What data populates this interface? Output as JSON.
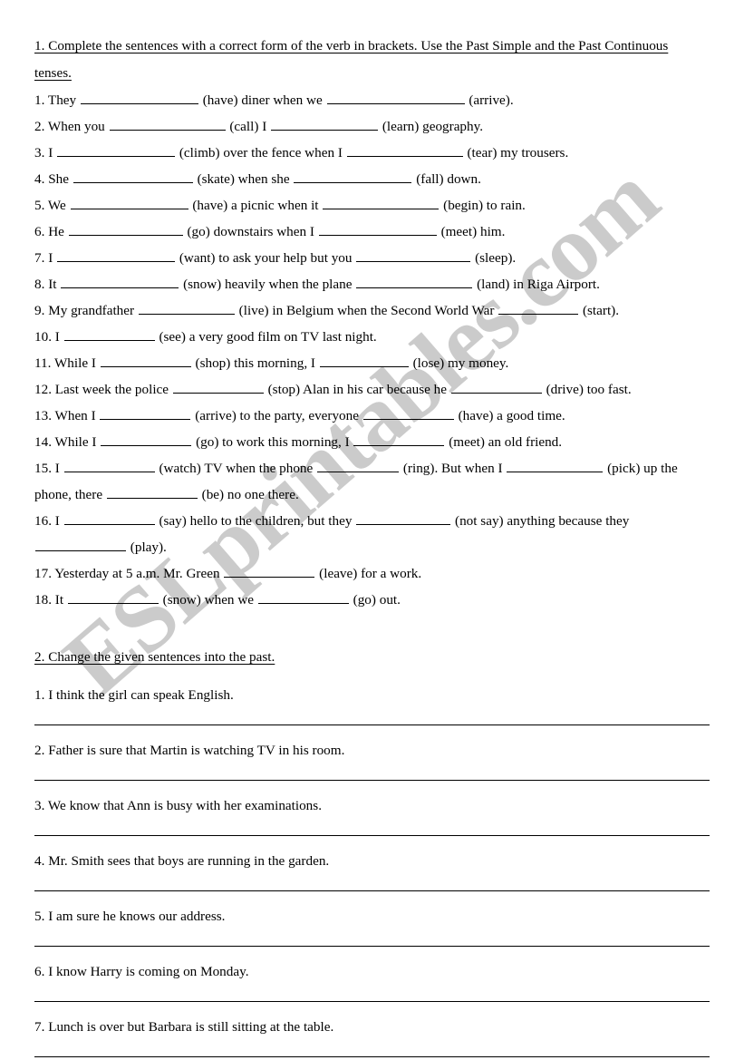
{
  "document": {
    "watermark": "ESLprintables.com",
    "accent_color": "#c9c9c9",
    "text_color": "#000000",
    "background_color": "#ffffff"
  },
  "task1": {
    "heading": "1. Complete the sentences with a correct form of the verb in brackets. Use the Past Simple and the Past Continuous tenses.",
    "items": [
      {
        "num": "1.",
        "p1": "They",
        "b1": 130,
        "p2": "(have) diner when we",
        "b2": 152,
        "p3": "(arrive)."
      },
      {
        "num": "2.",
        "p1": "When you",
        "b1": 128,
        "p2": "(call) I",
        "b2": 118,
        "p3": "(learn) geography."
      },
      {
        "num": "3.",
        "p1": "I",
        "b1": 130,
        "p2": "(climb) over the fence when I",
        "b2": 128,
        "p3": "(tear) my trousers."
      },
      {
        "num": "4.",
        "p1": "She",
        "b1": 132,
        "p2": "(skate) when she",
        "b2": 130,
        "p3": "(fall) down."
      },
      {
        "num": "5.",
        "p1": "We",
        "b1": 130,
        "p2": "(have) a picnic when it",
        "b2": 128,
        "p3": "(begin) to rain."
      },
      {
        "num": "6.",
        "p1": "He",
        "b1": 126,
        "p2": "(go) downstairs when I",
        "b2": 130,
        "p3": "(meet) him."
      },
      {
        "num": "7.",
        "p1": "I",
        "b1": 130,
        "p2": "(want) to ask your help but you",
        "b2": 126,
        "p3": "(sleep)."
      },
      {
        "num": "8.",
        "p1": "It",
        "b1": 130,
        "p2": "(snow) heavily when the plane",
        "b2": 128,
        "p3": "(land) in Riga Airport."
      },
      {
        "num": "9.",
        "p1": "My grandfather",
        "b1": 106,
        "p2": "(live) in Belgium when the Second World War",
        "b2": 88,
        "p3": "(start)."
      },
      {
        "num": "10.",
        "p1": "I",
        "b1": 100,
        "p2": "(see) a very good film on TV last night.",
        "b2": 0,
        "p3": ""
      },
      {
        "num": "11.",
        "p1": "While I",
        "b1": 100,
        "p2": "(shop) this morning, I",
        "b2": 98,
        "p3": "(lose) my money."
      },
      {
        "num": "12.",
        "p1": "Last week the police",
        "b1": 100,
        "p2": "(stop) Alan in his car because he",
        "b2": 100,
        "p3": "(drive) too fast."
      },
      {
        "num": "13.",
        "p1": "When I",
        "b1": 100,
        "p2": "(arrive) to the party, everyone",
        "b2": 100,
        "p3": "(have) a good time."
      },
      {
        "num": "14.",
        "p1": "While I",
        "b1": 100,
        "p2": "(go) to work this morning, I",
        "b2": 100,
        "p3": "(meet) an old friend."
      }
    ],
    "item15": {
      "num": "15.",
      "p1": "I",
      "b1": 100,
      "p2": "(watch) TV when the phone",
      "b2": 90,
      "p3": "(ring). But when I",
      "b3": 106,
      "p4": "(pick) up the phone, there",
      "b4": 100,
      "p5": "(be) no one there."
    },
    "item16": {
      "num": "16.",
      "p1": "I",
      "b1": 100,
      "p2": "(say) hello to the children, but they",
      "b2": 104,
      "p3": "(not say) anything because they",
      "b3": 100,
      "p4": "(play)."
    },
    "items_tail": [
      {
        "num": "17.",
        "p1": "Yesterday at 5 a.m. Mr. Green",
        "b1": 100,
        "p2": "(leave) for a work.",
        "b2": 0,
        "p3": ""
      },
      {
        "num": "18.",
        "p1": "It",
        "b1": 100,
        "p2": "(snow) when we",
        "b2": 100,
        "p3": "(go) out."
      }
    ]
  },
  "task2": {
    "heading": "2. Change the given sentences into the past.",
    "items": [
      {
        "num": "1.",
        "text": "I think the girl can speak English."
      },
      {
        "num": "2.",
        "text": "Father is sure that Martin is watching TV in his room."
      },
      {
        "num": "3.",
        "text": "We know that Ann is busy with her examinations."
      },
      {
        "num": "4.",
        "text": "Mr. Smith sees that boys are running in the garden."
      },
      {
        "num": "5.",
        "text": "I am sure he knows our address."
      },
      {
        "num": "6.",
        "text": "I know Harry is coming on Monday."
      },
      {
        "num": "7.",
        "text": "Lunch is over but Barbara is still sitting at the table."
      }
    ]
  }
}
